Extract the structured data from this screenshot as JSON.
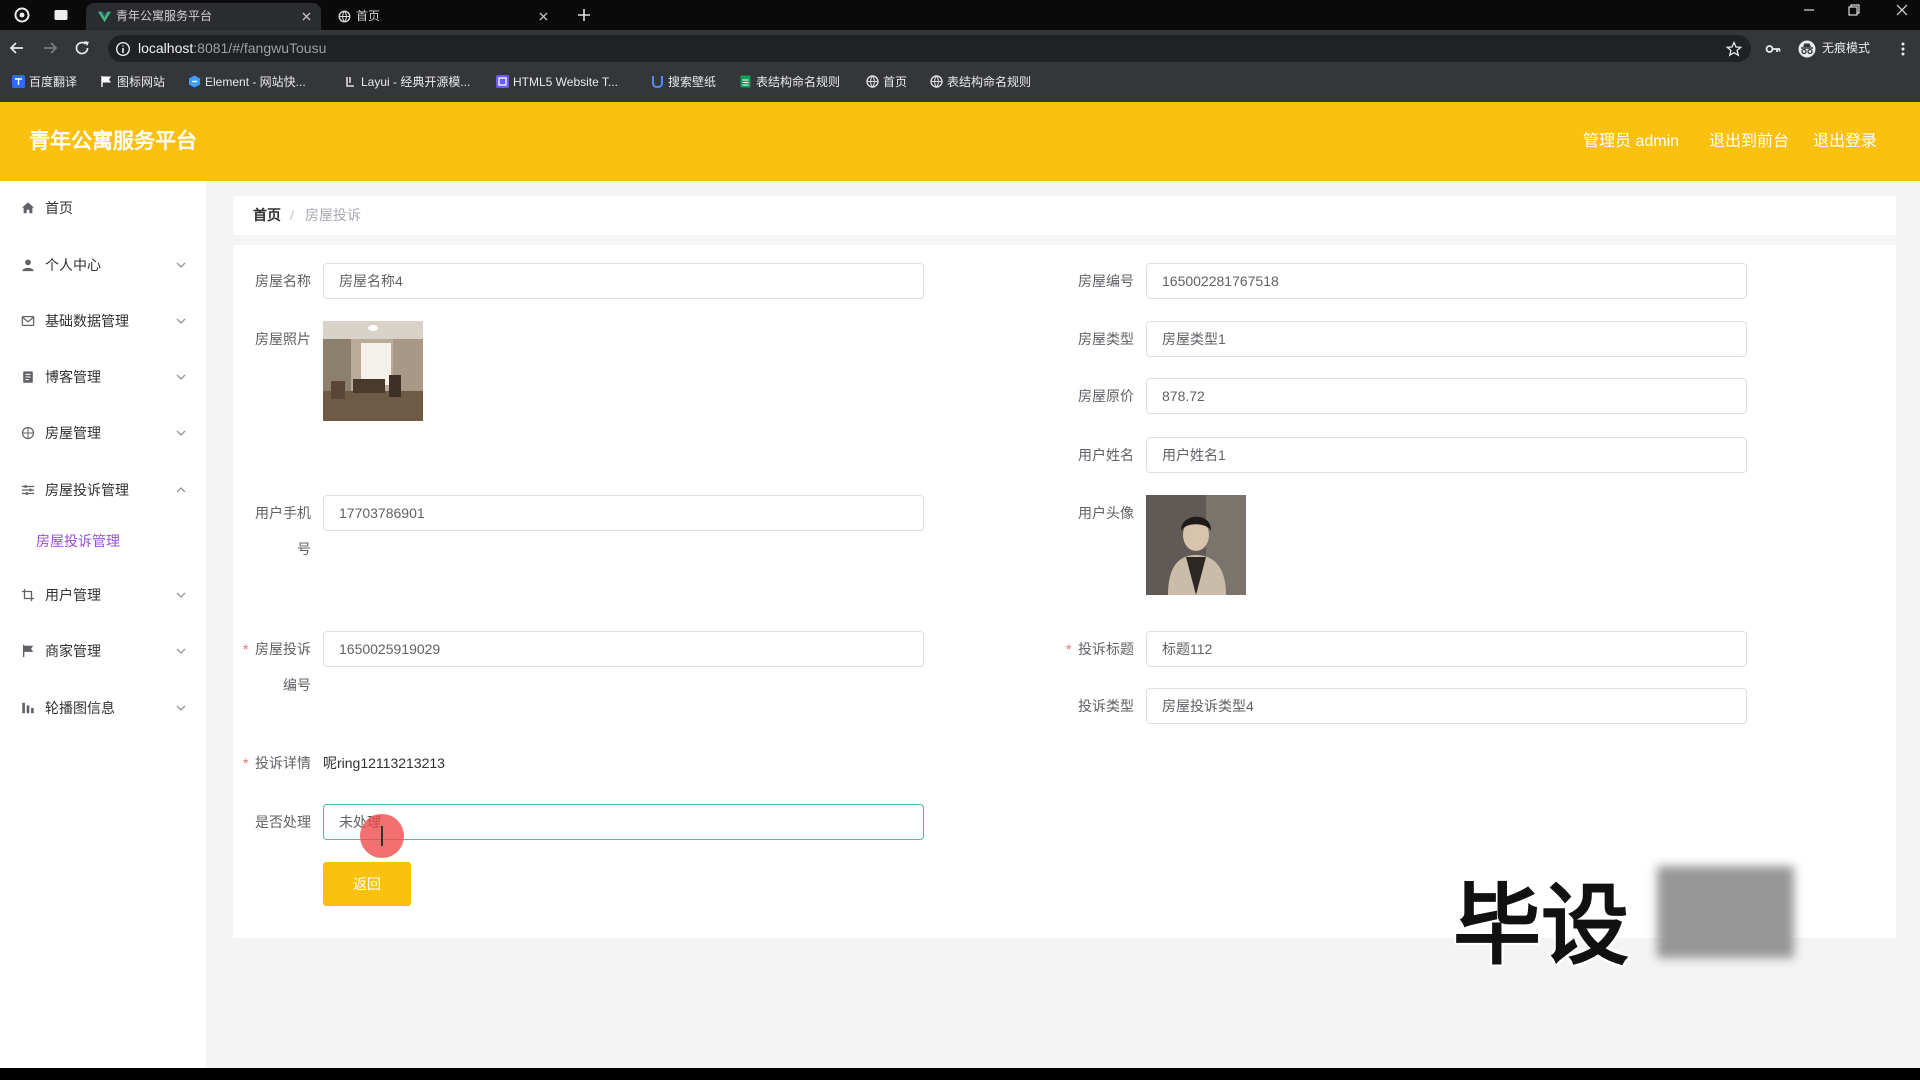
{
  "browser": {
    "tabs": [
      {
        "title": "青年公寓服务平台",
        "favicon": "vue-icon",
        "active": true
      },
      {
        "title": "首页",
        "favicon": "globe-icon",
        "active": false
      }
    ],
    "url": {
      "host": "localhost",
      "path": ":8081/#/fangwuTousu"
    },
    "profile": "无痕模式",
    "bookmarks": [
      {
        "label": "百度翻译",
        "icon": "translate-icon"
      },
      {
        "label": "图标网站",
        "icon": "flag-icon"
      },
      {
        "label": "Element - 网站快...",
        "icon": "element-icon"
      },
      {
        "label": "Layui - 经典开源模...",
        "icon": "layui-icon"
      },
      {
        "label": "HTML5 Website T...",
        "icon": "html5-icon"
      },
      {
        "label": "搜索壁纸",
        "icon": "wallpaper-icon"
      },
      {
        "label": "表结构命名规则",
        "icon": "sheet-icon"
      },
      {
        "label": "首页",
        "icon": "globe-icon"
      },
      {
        "label": "表结构命名规则",
        "icon": "globe-icon"
      }
    ],
    "window_controls": [
      "minimize-icon",
      "restore-icon",
      "close-icon"
    ]
  },
  "header": {
    "title": "青年公寓服务平台",
    "admin": "管理员 admin",
    "front": "退出到前台",
    "logout": "退出登录"
  },
  "sidebar": {
    "items": [
      {
        "label": "首页",
        "icon": "home-icon"
      },
      {
        "label": "个人中心",
        "icon": "user-icon"
      },
      {
        "label": "基础数据管理",
        "icon": "mail-icon"
      },
      {
        "label": "博客管理",
        "icon": "blog-icon"
      },
      {
        "label": "房屋管理",
        "icon": "compass-icon"
      },
      {
        "label": "房屋投诉管理",
        "icon": "sliders-icon",
        "expanded": true,
        "children": [
          {
            "label": "房屋投诉管理",
            "active": true
          }
        ]
      },
      {
        "label": "用户管理",
        "icon": "crop-icon"
      },
      {
        "label": "商家管理",
        "icon": "flag-icon"
      },
      {
        "label": "轮播图信息",
        "icon": "chart-icon"
      }
    ]
  },
  "breadcrumb": {
    "home": "首页",
    "separator": "/",
    "current": "房屋投诉"
  },
  "form": {
    "required_mark": "*",
    "house_name": {
      "label": "房屋名称",
      "value": "房屋名称4"
    },
    "house_photo": {
      "label": "房屋照片"
    },
    "phone": {
      "label": "用户手机号",
      "value": "17703786901"
    },
    "complaint_no": {
      "label": "房屋投诉编号",
      "value": "1650025919029",
      "required": true
    },
    "complaint_detail": {
      "label": "投诉详情",
      "value": "呢ring12113213213",
      "required": true
    },
    "handled": {
      "label": "是否处理",
      "value": "未处理"
    },
    "house_no": {
      "label": "房屋编号",
      "value": "165002281767518"
    },
    "house_type": {
      "label": "房屋类型",
      "value": "房屋类型1"
    },
    "price": {
      "label": "房屋原价",
      "value": "878.72"
    },
    "user_name": {
      "label": "用户姓名",
      "value": "用户姓名1"
    },
    "avatar": {
      "label": "用户头像"
    },
    "complaint_title": {
      "label": "投诉标题",
      "value": "标题112",
      "required": true
    },
    "complaint_type": {
      "label": "投诉类型",
      "value": "房屋投诉类型4"
    }
  },
  "actions": {
    "back": "返回"
  },
  "watermark": "毕设",
  "colors": {
    "header": "#fcc10f",
    "active_submenu": "#9c4fd0",
    "required": "#f56c6c",
    "focus_border": "#4fb7a5",
    "button": "#fcc10f"
  }
}
